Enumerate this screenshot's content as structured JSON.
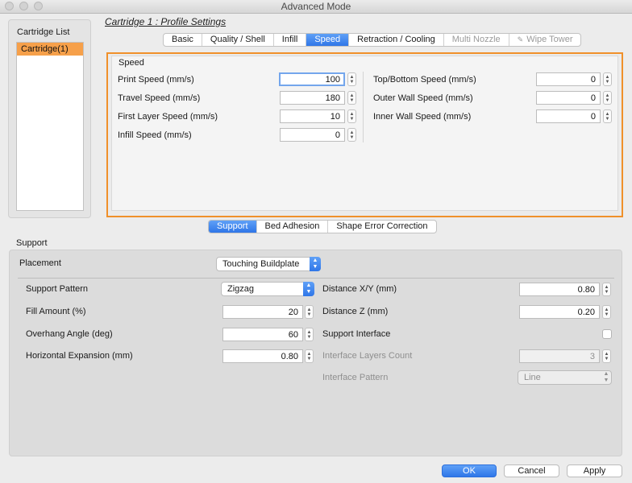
{
  "window": {
    "title": "Advanced Mode"
  },
  "cartridge_list": {
    "label": "Cartridge List",
    "items": [
      "Cartridge(1)"
    ]
  },
  "profile": {
    "title": "Cartridge 1 : Profile Settings"
  },
  "top_tabs": [
    {
      "label": "Basic"
    },
    {
      "label": "Quality / Shell"
    },
    {
      "label": "Infill"
    },
    {
      "label": "Speed",
      "active": true
    },
    {
      "label": "Retraction / Cooling"
    },
    {
      "label": "Multi Nozzle",
      "disabled": true
    },
    {
      "label": "Wipe Tower",
      "disabled": true
    }
  ],
  "speed": {
    "section_label": "Speed",
    "left": [
      {
        "label": "Print Speed (mm/s)",
        "value": "100"
      },
      {
        "label": "Travel Speed (mm/s)",
        "value": "180"
      },
      {
        "label": "First Layer Speed (mm/s)",
        "value": "10"
      },
      {
        "label": "Infill Speed (mm/s)",
        "value": "0"
      }
    ],
    "right": [
      {
        "label": "Top/Bottom Speed (mm/s)",
        "value": "0"
      },
      {
        "label": "Outer Wall Speed (mm/s)",
        "value": "0"
      },
      {
        "label": "Inner Wall Speed (mm/s)",
        "value": "0"
      }
    ]
  },
  "bottom_tabs": [
    {
      "label": "Support",
      "active": true
    },
    {
      "label": "Bed Adhesion"
    },
    {
      "label": "Shape Error Correction"
    }
  ],
  "support": {
    "section_label": "Support",
    "placement_label": "Placement",
    "placement_value": "Touching Buildplate",
    "left": {
      "pattern_label": "Support Pattern",
      "pattern_value": "Zigzag",
      "fill_label": "Fill Amount (%)",
      "fill_value": "20",
      "overhang_label": "Overhang Angle (deg)",
      "overhang_value": "60",
      "expansion_label": "Horizontal Expansion (mm)",
      "expansion_value": "0.80"
    },
    "right": {
      "dist_xy_label": "Distance X/Y (mm)",
      "dist_xy_value": "0.80",
      "dist_z_label": "Distance Z (mm)",
      "dist_z_value": "0.20",
      "interface_label": "Support Interface",
      "interface_checked": false,
      "layers_label": "Interface Layers Count",
      "layers_value": "3",
      "iface_pattern_label": "Interface Pattern",
      "iface_pattern_value": "Line"
    }
  },
  "buttons": {
    "ok": "OK",
    "cancel": "Cancel",
    "apply": "Apply"
  },
  "colors": {
    "accent_blue": "#2f76e8",
    "highlight_orange": "#f0902a"
  }
}
